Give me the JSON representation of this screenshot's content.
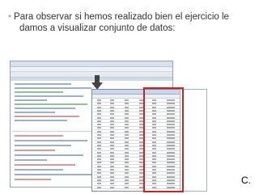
{
  "slide": {
    "text_line1": "Para observar si hemos realizado bien el ejercicio le",
    "text_line2": "damos a visualizar conjunto de datos:",
    "bullet": "•",
    "page_marker": "C."
  },
  "colors": {
    "highlight": "#cc2222",
    "bullet": "#8fb5cf",
    "arrow": "#444444"
  },
  "icons": {
    "arrow": "down-arrow-icon"
  }
}
